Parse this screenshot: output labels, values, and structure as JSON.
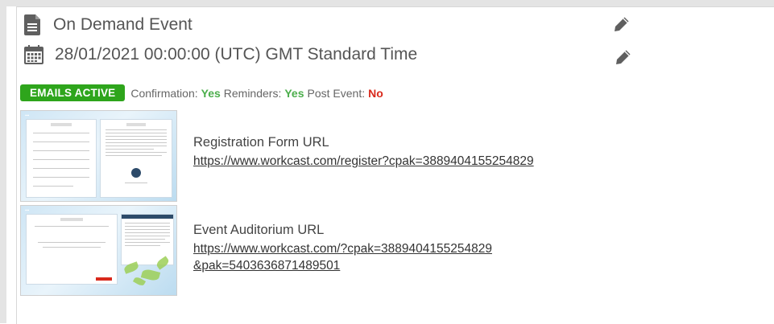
{
  "event": {
    "title": "On Demand Event",
    "datetime": "28/01/2021 00:00:00 (UTC) GMT Standard Time",
    "title_icon": "document-icon",
    "date_icon": "calendar-icon",
    "edit_icon": "pencil-icon"
  },
  "emails": {
    "badge": "EMAILS ACTIVE",
    "confirmation_label": "Confirmation:",
    "confirmation_value": "Yes",
    "reminders_label": "Reminders:",
    "reminders_value": "Yes",
    "post_event_label": "Post Event:",
    "post_event_value": "No"
  },
  "links": {
    "registration_title": "Registration Form URL",
    "registration_url": "https://www.workcast.com/register?cpak=3889404155254829",
    "auditorium_title": "Event Auditorium URL",
    "auditorium_url": "https://www.workcast.com/?cpak=3889404155254829&pak=5403636871489501"
  },
  "colors": {
    "badge_green": "#2ea51c",
    "yes_green": "#4cae4c",
    "no_red": "#d9291c"
  }
}
